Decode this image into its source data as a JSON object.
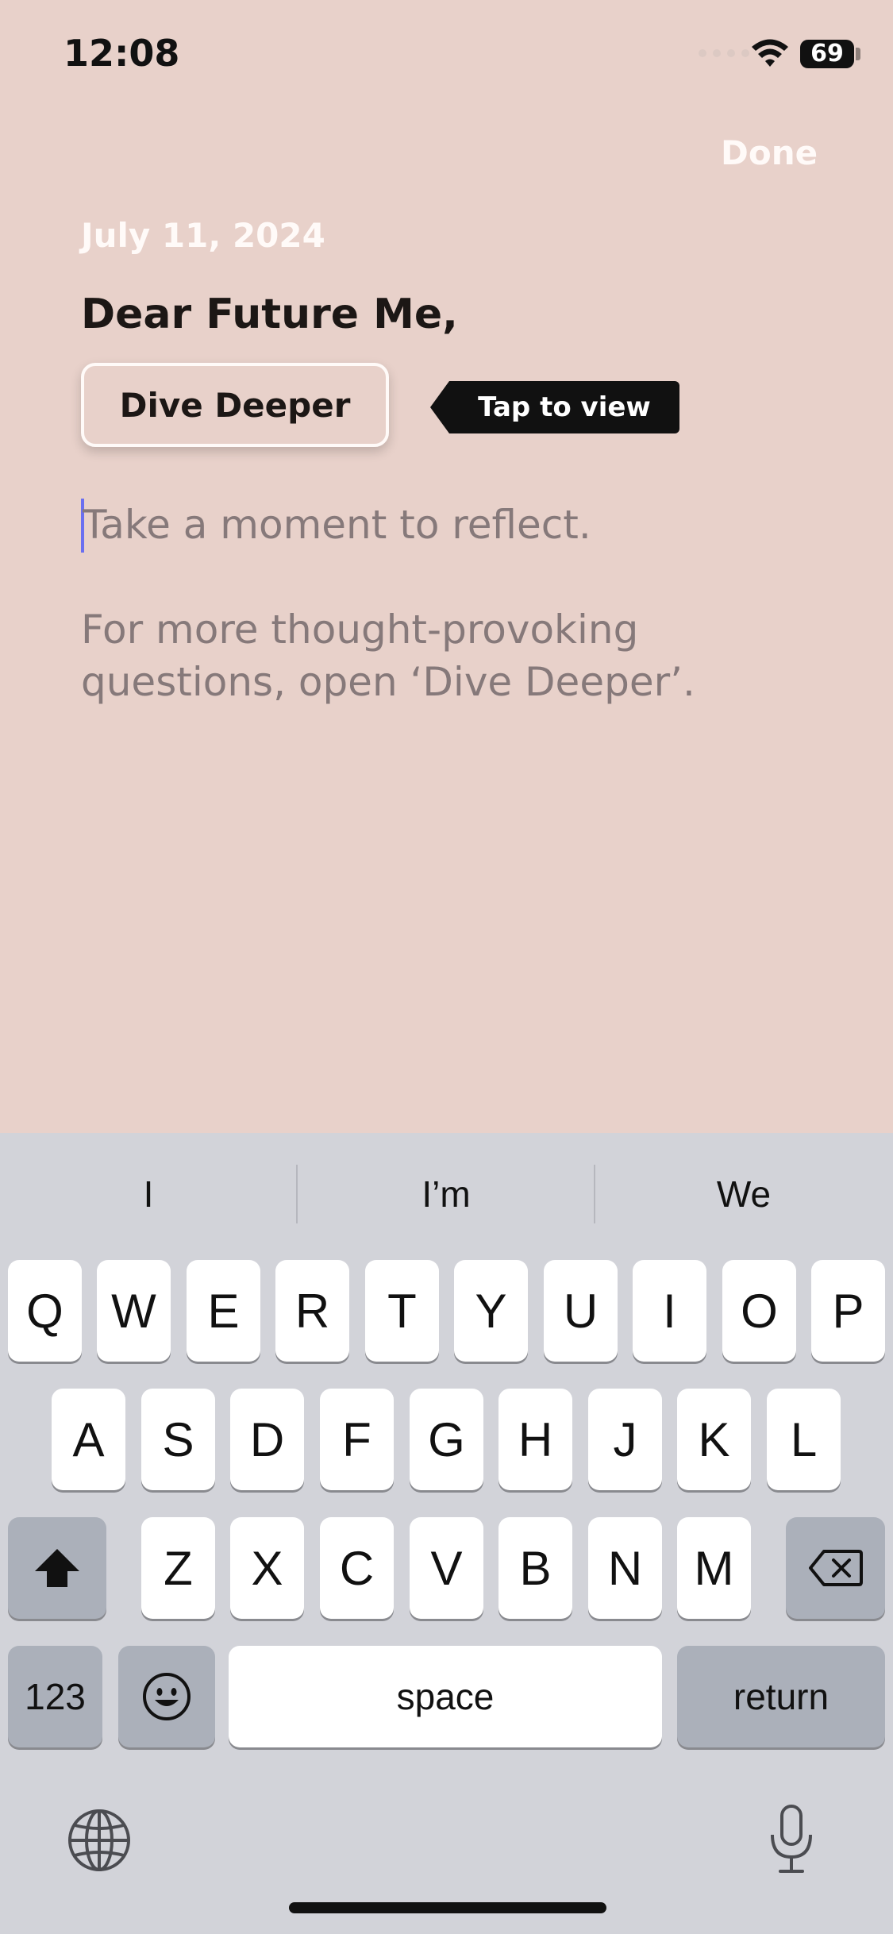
{
  "status_bar": {
    "time": "12:08",
    "battery": "69"
  },
  "header": {
    "done_label": "Done"
  },
  "journal": {
    "date": "July 11, 2024",
    "greeting": "Dear Future Me,",
    "dive_button_label": "Dive Deeper",
    "tooltip_label": "Tap to view",
    "placeholder": "Take a moment to reflect.",
    "hint_line1": "For more thought-provoking",
    "hint_line2": "questions, open ‘Dive Deeper’."
  },
  "keyboard": {
    "predictions": [
      "I",
      "I’m",
      "We"
    ],
    "row1": [
      "Q",
      "W",
      "E",
      "R",
      "T",
      "Y",
      "U",
      "I",
      "O",
      "P"
    ],
    "row2": [
      "A",
      "S",
      "D",
      "F",
      "G",
      "H",
      "J",
      "K",
      "L"
    ],
    "row3": [
      "Z",
      "X",
      "C",
      "V",
      "B",
      "N",
      "M"
    ],
    "numbers_label": "123",
    "space_label": "space",
    "return_label": "return",
    "icons": [
      "shift-icon",
      "delete-icon",
      "emoji-icon",
      "globe-icon",
      "microphone-icon"
    ]
  },
  "colors": {
    "background": "#e8d1ca",
    "keyboard_bg": "#d2d3d9",
    "cursor": "#6a6ff0"
  }
}
